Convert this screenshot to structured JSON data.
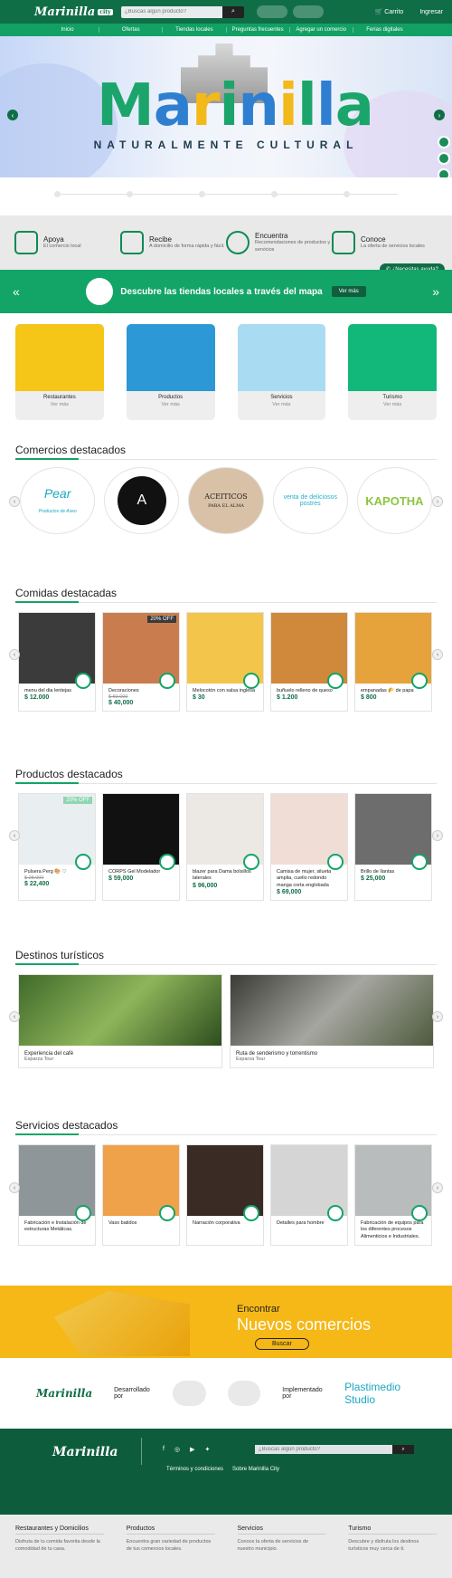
{
  "header": {
    "logo": "Marinilla",
    "logo_tag": "city",
    "search_placeholder": "¿Buscas algún producto?",
    "cart": "Carrito",
    "login": "Ingresar"
  },
  "nav": [
    "Inicio",
    "Ofertas",
    "Tiendas locales",
    "Preguntas frecuentes",
    "Agregar un comercio",
    "Ferias digitales"
  ],
  "hero": {
    "title": "Marinilla",
    "subtitle": "NATURALMENTE CULTURAL"
  },
  "features": [
    {
      "title": "Apoya",
      "text": "El comercio local"
    },
    {
      "title": "Recibe",
      "text": "A domicilio de forma rápida y fácil."
    },
    {
      "title": "Encuentra",
      "text": "Recomendaciones de productos y servicios"
    },
    {
      "title": "Conoce",
      "text": "La oferta de servicios locales"
    }
  ],
  "help": "¿Necesitas ayuda?",
  "map_banner": {
    "text": "Descubre las tiendas locales a través del mapa",
    "button": "Ver más"
  },
  "categories": [
    {
      "name": "Restaurantes",
      "more": "Ver más",
      "bg": "#f5c518"
    },
    {
      "name": "Productos",
      "more": "Ver más",
      "bg": "#2c98d6"
    },
    {
      "name": "Servicios",
      "more": "Ver más",
      "bg": "#a9dcf2"
    },
    {
      "name": "Turismo",
      "more": "Ver más",
      "bg": "#12b77a"
    }
  ],
  "comercios": {
    "title": "Comercios destacados",
    "items": [
      {
        "name": "Pear",
        "sub": "Productos de Aseo"
      },
      {
        "name": "A",
        "sub": ""
      },
      {
        "name": "ACEITICOS",
        "sub": "PARA EL ALMA"
      },
      {
        "name": "venta de deliciosos postres",
        "sub": ""
      },
      {
        "name": "KAPOTHA",
        "sub": ""
      }
    ]
  },
  "comidas": {
    "title": "Comidas destacadas",
    "items": [
      {
        "name": "menu del dia lentejas",
        "old": "",
        "price": "$ 12.000",
        "badge": ""
      },
      {
        "name": "Decoraciones",
        "old": "$ 50.000",
        "price": "$ 40,000",
        "badge": "20% OFF"
      },
      {
        "name": "Melocotón con salsa inglesa",
        "old": "",
        "price": "$ 30",
        "badge": ""
      },
      {
        "name": "buñuelo relleno de queso",
        "old": "",
        "price": "$ 1.200",
        "badge": ""
      },
      {
        "name": "empanadas 🌮 de papa",
        "old": "",
        "price": "$ 800",
        "badge": ""
      }
    ]
  },
  "productos": {
    "title": "Productos destacados",
    "items": [
      {
        "name": "Pulsera Perg 🎨 ♡",
        "old": "$ 28.000",
        "price": "$ 22,400",
        "badge": "20% OFF"
      },
      {
        "name": "CORPS Gel Modelador",
        "old": "",
        "price": "$ 59,000",
        "badge": ""
      },
      {
        "name": "blazer para Dama bolsillos laterales",
        "old": "",
        "price": "$ 96,000",
        "badge": ""
      },
      {
        "name": "Camisa de mujer, silueta amplia, cuello redondo manga corta englobada",
        "old": "",
        "price": "$ 69,000",
        "badge": ""
      },
      {
        "name": "Brillo de llantas",
        "old": "",
        "price": "$ 25,000",
        "badge": ""
      }
    ]
  },
  "destinos": {
    "title": "Destinos turísticos",
    "items": [
      {
        "name": "Experiencia del café",
        "sub": "Esparza Tour"
      },
      {
        "name": "Ruta de senderismo y torrentismo",
        "sub": "Esparza Tour"
      }
    ]
  },
  "servicios": {
    "title": "Servicios destacados",
    "items": [
      {
        "name": "Fabricación e Instalación de estructuras Metálicas."
      },
      {
        "name": "Vaso batidos"
      },
      {
        "name": "Narración corporativa"
      },
      {
        "name": "Detalles para hombre"
      },
      {
        "name": "Fabricación de equipos para los diferentes procesos Alimenticios e Industriales."
      }
    ]
  },
  "promo": {
    "line1": "Encontrar",
    "line2": "Nuevos comercios",
    "button": "Buscar"
  },
  "dev": {
    "logo": "Marinilla",
    "by": "Desarrollado por",
    "impl": "Implementado por",
    "impl_logo": "Plastimedio Studio"
  },
  "footer": {
    "logo": "Marinilla",
    "search_placeholder": "¿Buscas algún producto?",
    "terms": "Términos y condiciones",
    "about": "Sobre Marinilla City",
    "cols": [
      {
        "title": "Restaurantes y Domicilios",
        "text": "Disfruta de tu comida favorita desde la comodidad de tu casa."
      },
      {
        "title": "Productos",
        "text": "Encuentra gran variedad de productos de tus comercios locales."
      },
      {
        "title": "Servicios",
        "text": "Conoce la oferta de servicios de nuestro municipio."
      },
      {
        "title": "Turismo",
        "text": "Descubre y disfruta los destinos turísticos muy cerca de ti."
      }
    ]
  }
}
